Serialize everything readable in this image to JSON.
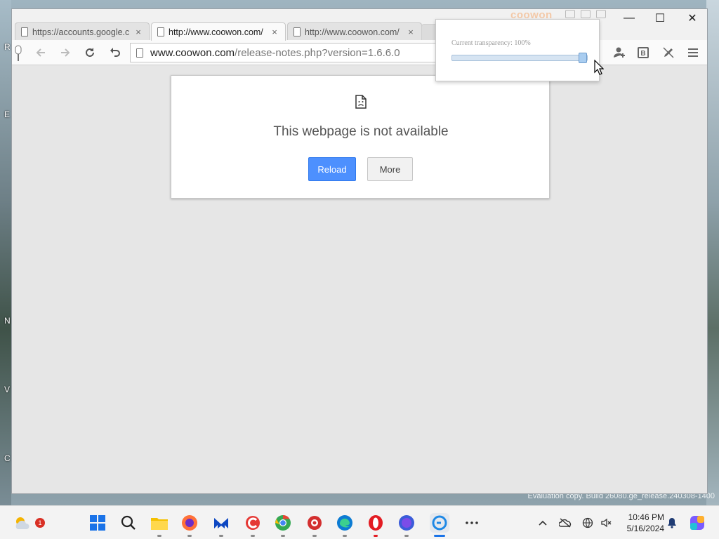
{
  "browser": {
    "brand": "coowon",
    "tabs": [
      {
        "title": "https://accounts.google.c",
        "close": "×",
        "active": false
      },
      {
        "title": "http://www.coowon.com/",
        "close": "×",
        "active": true
      },
      {
        "title": "http://www.coowon.com/",
        "close": "×",
        "active": false
      }
    ],
    "window_controls": {
      "minimize": "—",
      "maximize": "☐",
      "close": "✕"
    },
    "toolbar": {
      "back_icon": "arrow-left-icon",
      "forward_icon": "arrow-right-icon",
      "reload_icon": "reload-icon",
      "undo_icon": "undo-icon",
      "right_icons": [
        "user-add-icon",
        "bookmark-b-icon",
        "pen-icon",
        "menu-icon"
      ]
    },
    "url": {
      "host": "www.coowon.com",
      "path": "/release-notes.php?version=1.6.6.0"
    }
  },
  "error_page": {
    "title": "This webpage is not available",
    "reload_label": "Reload",
    "more_label": "More"
  },
  "transparency_popup": {
    "label": "Current transparency: 100%",
    "value_percent": 100
  },
  "desktop": {
    "watermark": "Evaluation copy. Build 26080.ge_release.240308-1400"
  },
  "taskbar": {
    "weather_badge": "1",
    "apps": [
      "start-icon",
      "search-icon",
      "file-explorer-icon",
      "firefox-icon",
      "malwarebytes-icon",
      "ccleaner-icon",
      "chrome-icon",
      "app-red-icon",
      "edge-icon",
      "opera-icon",
      "app-purple-icon",
      "coowon-icon",
      "more-apps-icon"
    ],
    "clock_time": "10:46 PM",
    "clock_date": "5/16/2024"
  },
  "colors": {
    "accent": "#4d90fe",
    "taskbar_active": "#1a73e8"
  }
}
